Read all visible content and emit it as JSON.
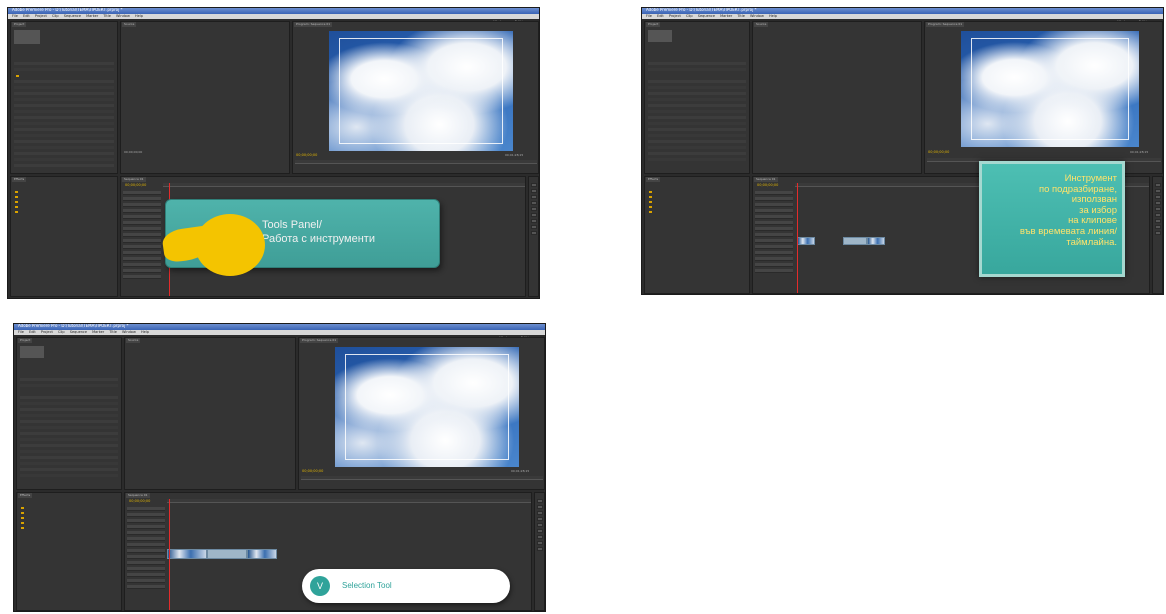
{
  "app_title": "Adobe Premiere Pro - D:\\Tutorial\\ТЕМА\\ПРОЕКТ.prproj *",
  "menu": [
    "File",
    "Edit",
    "Project",
    "Clip",
    "Sequence",
    "Marker",
    "Title",
    "Window",
    "Help"
  ],
  "workspace_label": "Workspace: Editing",
  "timecode_yellow": "00;00;00;00",
  "timecode_gray": "00;01;28;15",
  "project_items": [
    "Sequence 01",
    "Clip 01",
    "Clip 02",
    "Bin",
    "Audio",
    "Video",
    "Titles",
    "Cloud Sky",
    "Clip 03"
  ],
  "bottom_left_items": [
    "Presets",
    "Audio Effects",
    "Audio Transitions",
    "Video Effects",
    "Video Transitions"
  ],
  "callouts": {
    "tools_panel_line1": "Tools Panel/",
    "tools_panel_line2": "Работа с инструменти",
    "selection_desc_lines": [
      "Инструмент",
      "по подразбиране,",
      "използван",
      "за избор",
      "на клипове",
      "във времевата линия/",
      "таймлайна."
    ],
    "selection_tool_icon": "V",
    "selection_tool_label": "Selection Tool"
  },
  "colors": {
    "teal": "#3f9e97",
    "yellow": "#f4c400",
    "text_yellow": "#ffe36a",
    "playhead": "#e32b2b"
  }
}
